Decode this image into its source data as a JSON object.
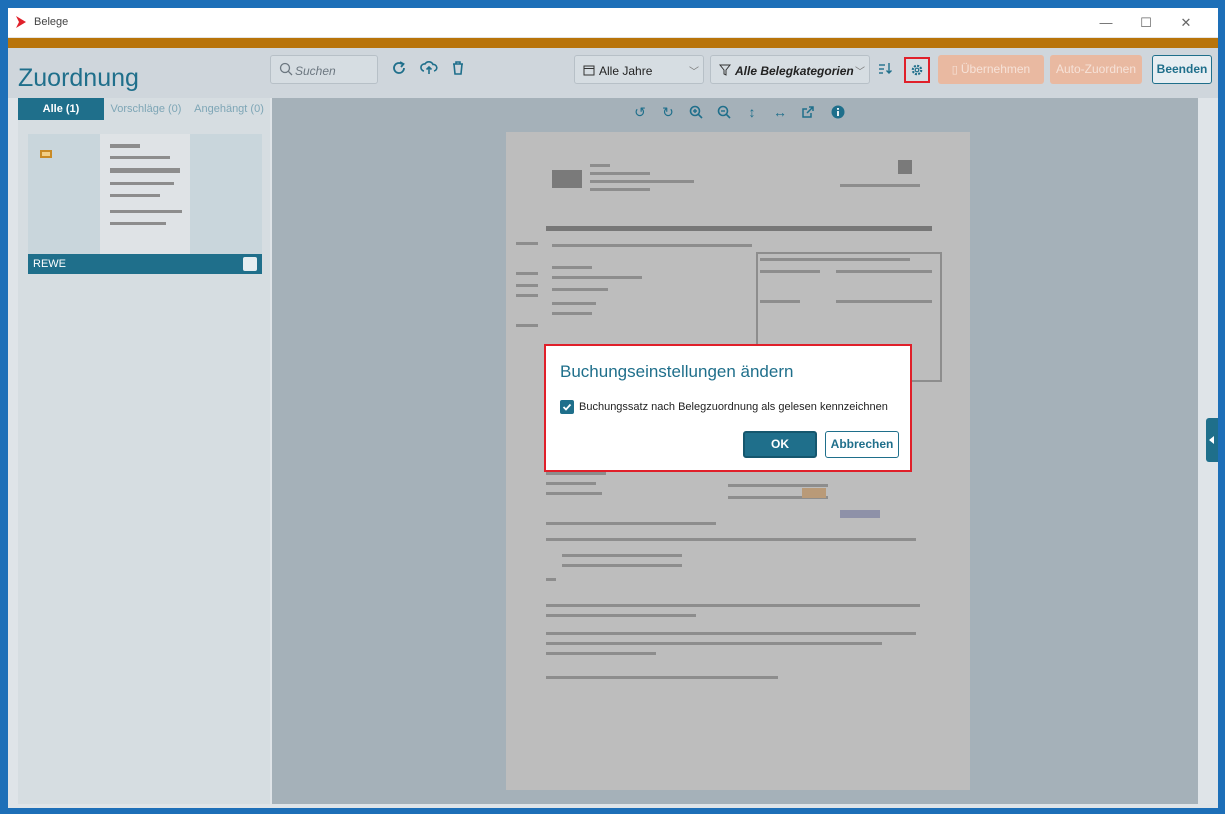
{
  "window": {
    "title": "Belege",
    "controls": {
      "minimize": "—",
      "maximize": "☐",
      "close": "✕"
    }
  },
  "header": {
    "title": "Zuordnung",
    "search": {
      "placeholder": "Suchen"
    },
    "year_filter": "Alle Jahre",
    "category_filter": "Alle Belegkategorien",
    "buttons": {
      "uebernehmen": "Übernehmen",
      "auto_zuordnen": "Auto-Zuordnen",
      "beenden": "Beenden"
    },
    "icons": [
      "search-icon",
      "refresh-icon",
      "upload-icon",
      "delete-icon",
      "calendar-icon",
      "filter-icon",
      "sort-icon",
      "settings-gear-icon",
      "clipboard-icon"
    ]
  },
  "left_pane": {
    "tabs": [
      {
        "label": "Alle (1)",
        "active": true
      },
      {
        "label": "Vorschläge (0)",
        "active": false
      },
      {
        "label": "Angehängt (0)",
        "active": false
      }
    ],
    "documents": [
      {
        "name": "REWE"
      }
    ]
  },
  "viewer": {
    "tools": [
      "rotate-left-icon",
      "rotate-right-icon",
      "zoom-in-icon",
      "zoom-out-icon",
      "fit-height-icon",
      "fit-width-icon",
      "open-external-icon",
      "info-icon"
    ]
  },
  "dialog": {
    "title": "Buchungseinstellungen ändern",
    "checkbox_label": "Buchungssatz nach Belegzuordnung als gelesen kennzeichnen",
    "checked": true,
    "ok_label": "OK",
    "cancel_label": "Abbrechen"
  },
  "colors": {
    "accent_teal": "#1f6f8b",
    "accent_orange": "#b8740a",
    "highlight_red": "#e0202a",
    "frame_blue": "#1d6fb8"
  }
}
